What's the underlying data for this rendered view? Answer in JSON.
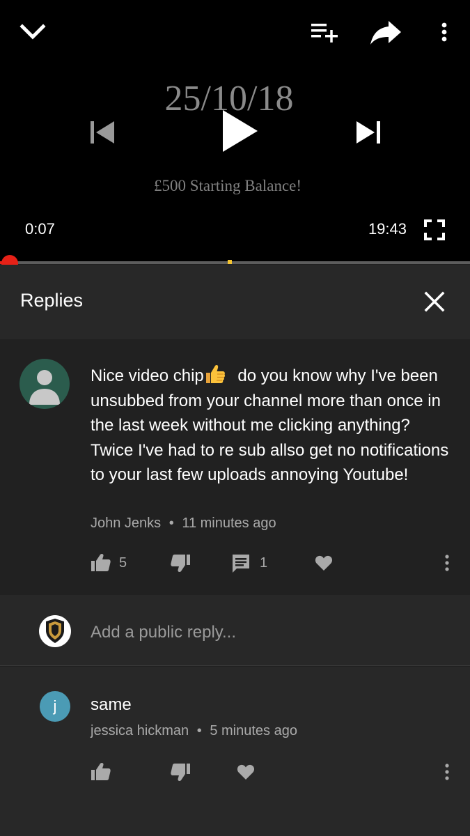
{
  "player": {
    "slide_date": "25/10/18",
    "slide_subtitle": "£500 Starting Balance!",
    "current_time": "0:07",
    "duration": "19:43",
    "progress_fraction": 0.006,
    "icons": [
      "chevron-down-icon",
      "add-to-queue-icon",
      "share-icon",
      "more-vert-icon",
      "skip-previous-icon",
      "play-icon",
      "skip-next-icon",
      "fullscreen-icon"
    ]
  },
  "replies_panel": {
    "title": "Replies",
    "close_icon": "close-icon"
  },
  "parent_comment": {
    "text_before_emoji": "Nice video chip",
    "emoji": "thumbs-up-emoji",
    "text_after_emoji": " do you know why I've been unsubbed from your channel more than once in the last week without me clicking anything? Twice I've had to re sub allso get no notifications to your last few uploads annoying Youtube!",
    "author": "John Jenks",
    "separator": "•",
    "time": "11 minutes ago",
    "like_count": "5",
    "reply_count": "1"
  },
  "reply_input": {
    "placeholder": "Add a public reply..."
  },
  "reply": {
    "avatar_letter": "j",
    "text": "same",
    "author": "jessica hickman",
    "separator": "•",
    "time": "5 minutes ago"
  },
  "colors": {
    "progress": "#e62117",
    "panel_bg": "#282828",
    "comment_bg": "#212121",
    "avatar_john": "#2b5c4d",
    "avatar_jessica": "#4b9bb5"
  }
}
